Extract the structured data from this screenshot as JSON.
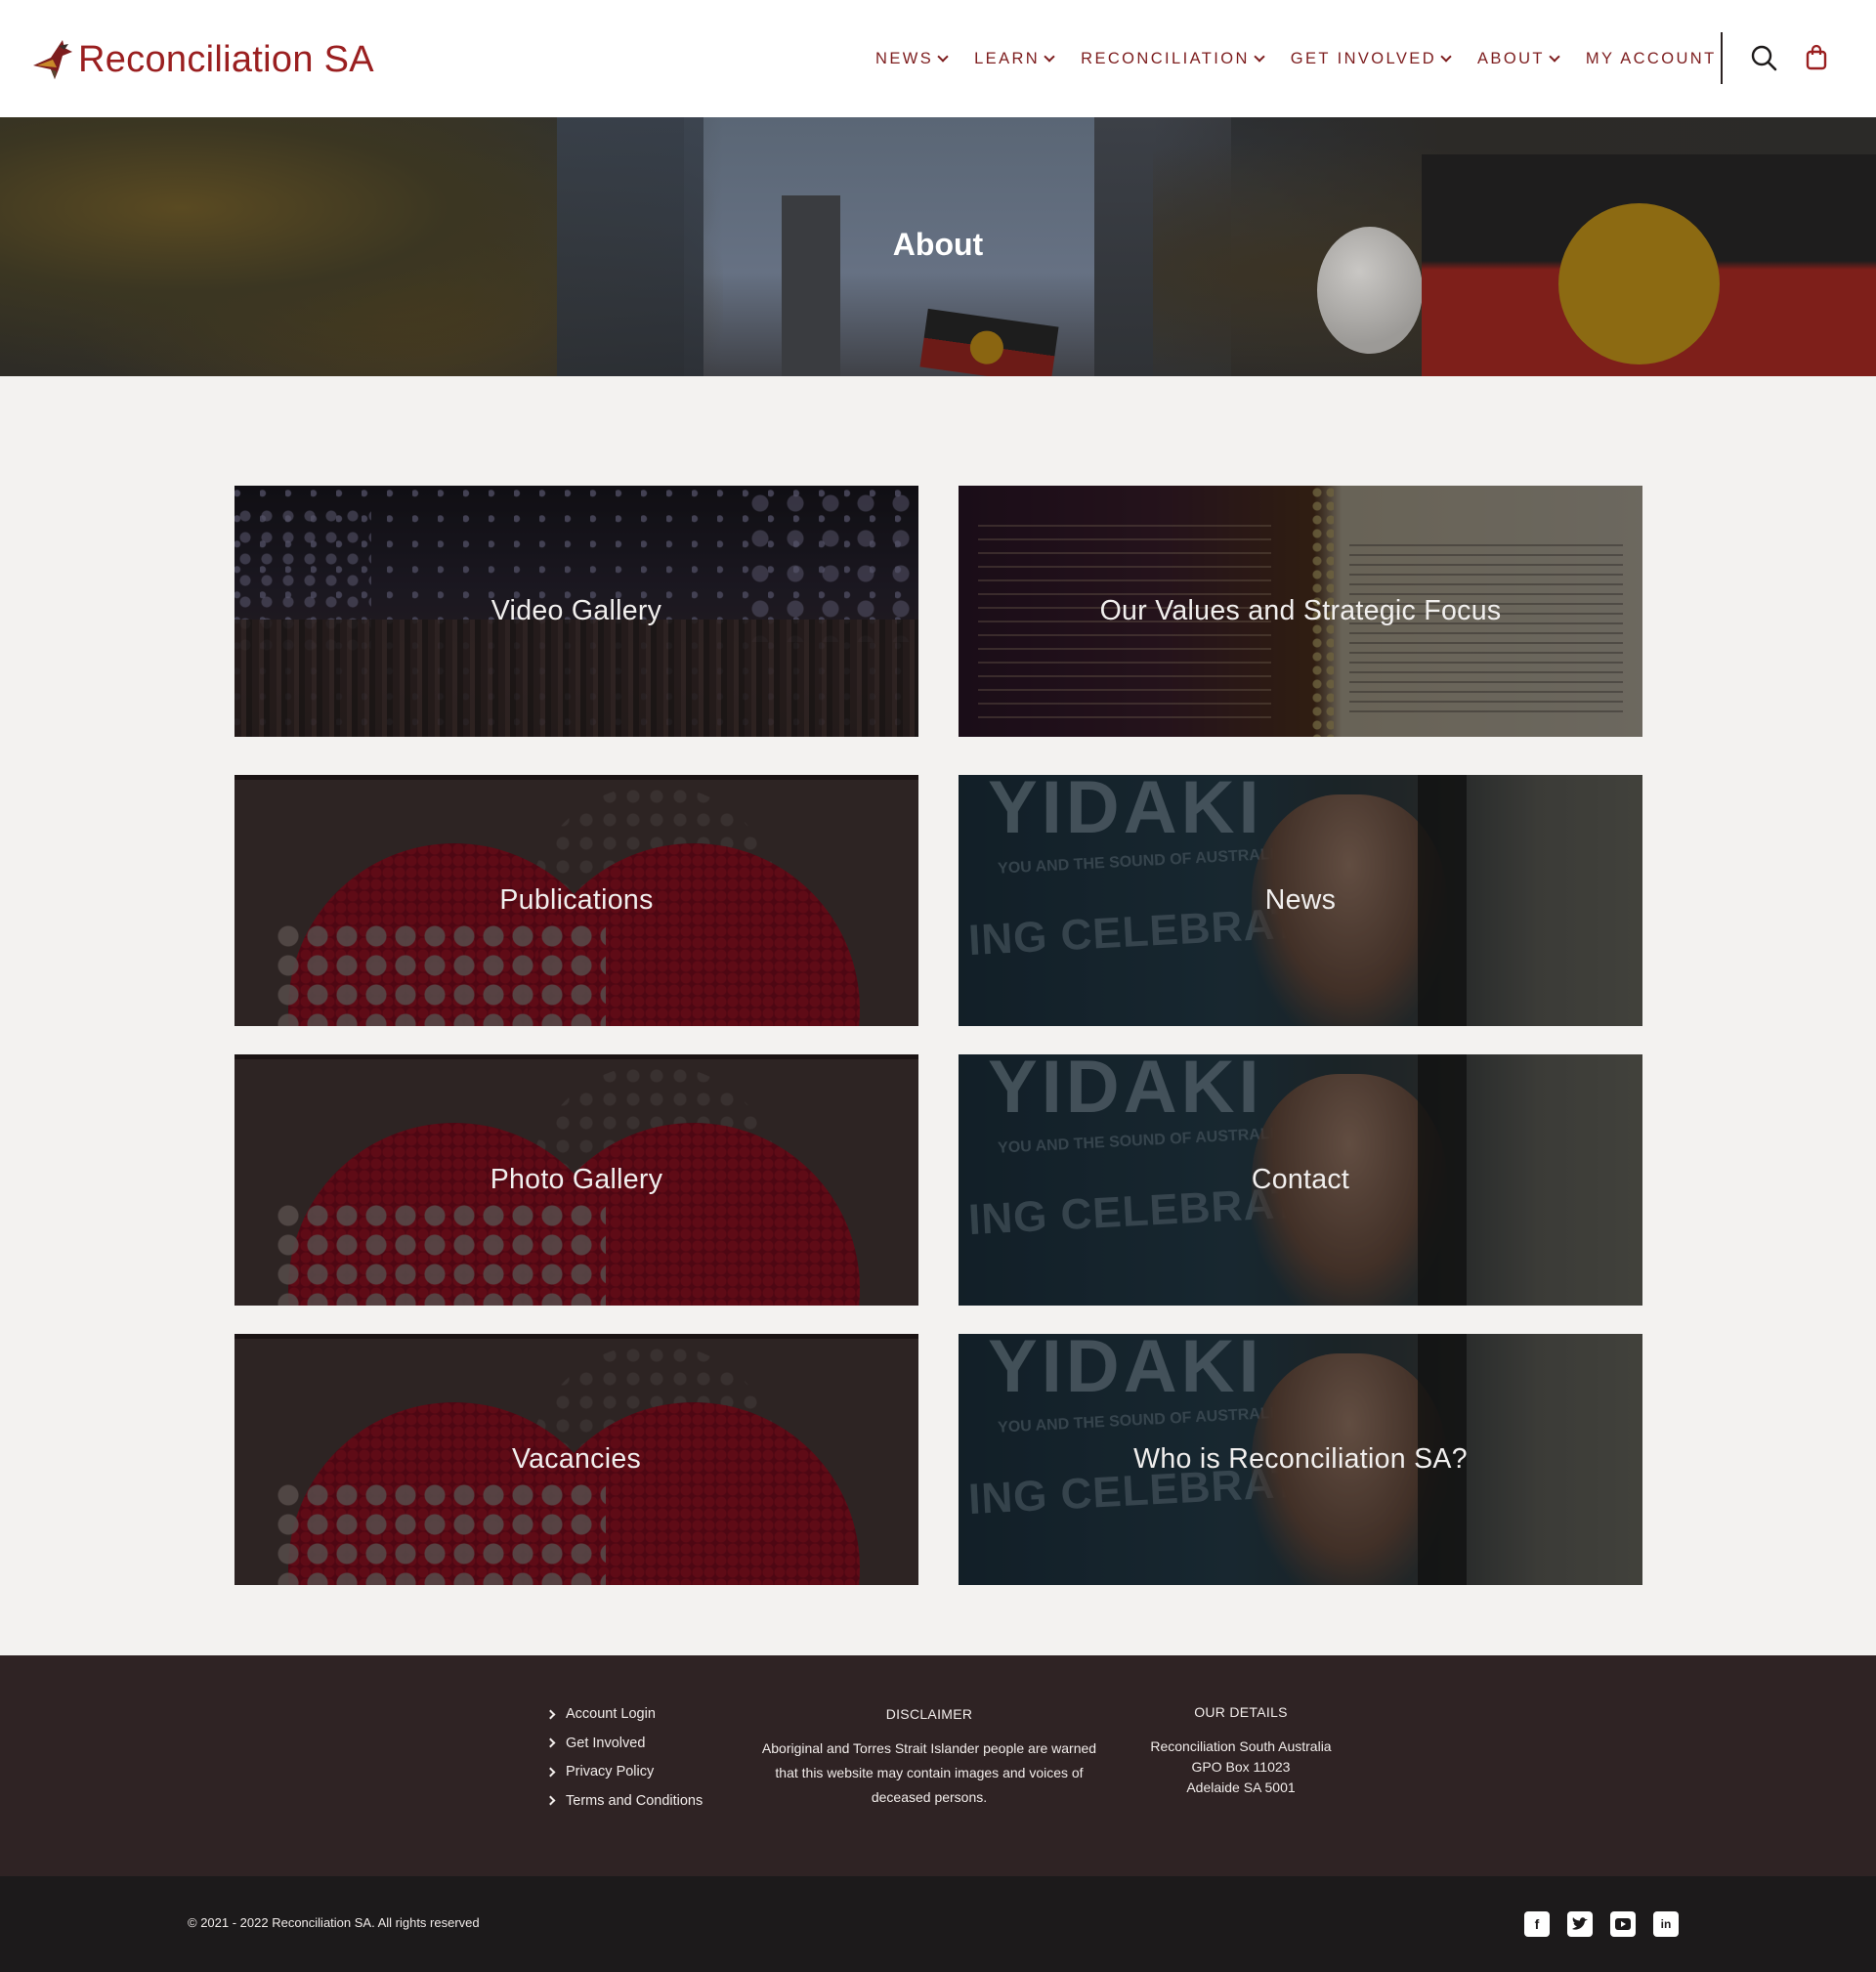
{
  "header": {
    "logo_text": "Reconciliation SA",
    "nav": [
      {
        "label": "NEWS",
        "dropdown": true
      },
      {
        "label": "LEARN",
        "dropdown": true
      },
      {
        "label": "RECONCILIATION",
        "dropdown": true
      },
      {
        "label": "GET INVOLVED",
        "dropdown": true
      },
      {
        "label": "ABOUT",
        "dropdown": true
      },
      {
        "label": "MY ACCOUNT",
        "dropdown": false
      }
    ],
    "icons": [
      "search-icon",
      "cart-icon"
    ]
  },
  "hero": {
    "title": "About"
  },
  "cards": [
    {
      "label": "Video Gallery"
    },
    {
      "label": "Our Values and Strategic Focus"
    },
    {
      "label": "Publications"
    },
    {
      "label": "News"
    },
    {
      "label": "Photo Gallery"
    },
    {
      "label": "Contact"
    },
    {
      "label": "Vacancies"
    },
    {
      "label": "Who is Reconciliation SA?"
    }
  ],
  "footer": {
    "links": [
      "Account Login",
      "Get Involved",
      "Privacy Policy",
      "Terms and Conditions"
    ],
    "disclaimer": {
      "heading": "DISCLAIMER",
      "text": "Aboriginal and Torres Strait Islander people are warned that this website may contain images and voices of deceased persons."
    },
    "details": {
      "heading": "OUR DETAILS",
      "lines": [
        "Reconciliation South Australia",
        "GPO Box 11023",
        "Adelaide SA 5001"
      ]
    }
  },
  "bottom_bar": {
    "copyright": "© 2021 - 2022 Reconciliation SA. All rights reserved",
    "social": [
      "facebook-icon",
      "twitter-icon",
      "youtube-icon",
      "linkedin-icon"
    ]
  },
  "colors": {
    "brand": "#9a1f20",
    "nav_text": "#7d1d1e",
    "footer_bg": "#2f2324",
    "bottom_bg": "#1c1a1b",
    "page_bg": "#f3f2f0"
  }
}
